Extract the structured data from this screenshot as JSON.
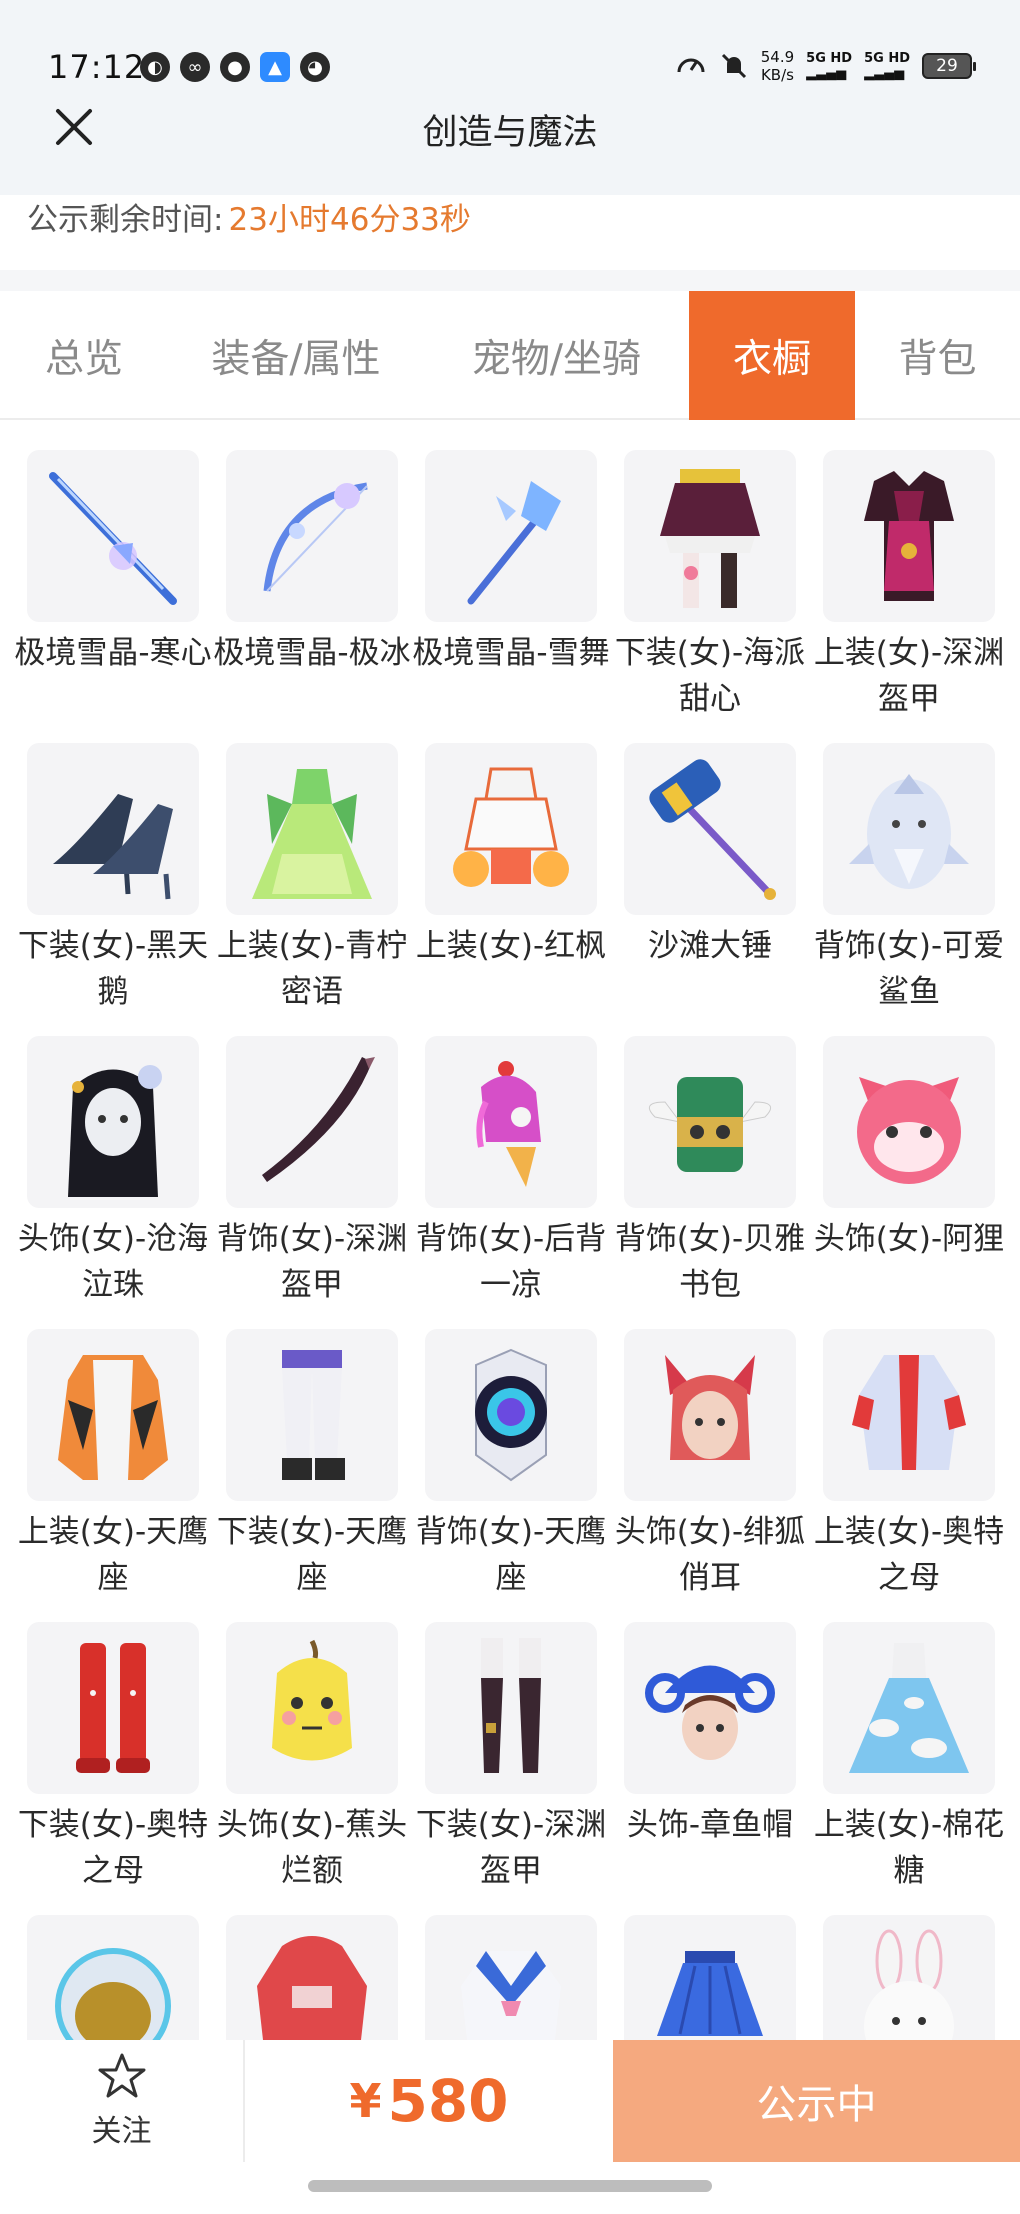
{
  "status_bar": {
    "time": "17:12",
    "net_speed_value": "54.9",
    "net_speed_unit": "KB/s",
    "sim1": "5G HD",
    "sim2": "5G HD",
    "battery": "29"
  },
  "header": {
    "title": "创造与魔法",
    "close_icon": "close-icon"
  },
  "notice": {
    "label": "公示剩余时间:",
    "value": "23小时46分33秒"
  },
  "tabs": [
    {
      "label": "总览",
      "active": false
    },
    {
      "label": "装备/属性",
      "active": false
    },
    {
      "label": "宠物/坐骑",
      "active": false
    },
    {
      "label": "衣橱",
      "active": true
    },
    {
      "label": "背包",
      "active": false
    }
  ],
  "items": [
    {
      "name": "极境雪晶-寒心",
      "icon": "ice-sword-icon"
    },
    {
      "name": "极境雪晶-极冰",
      "icon": "ice-bow-icon"
    },
    {
      "name": "极境雪晶-雪舞",
      "icon": "ice-staff-icon"
    },
    {
      "name": "下装(女)-海派甜心",
      "icon": "skirt-icon"
    },
    {
      "name": "上装(女)-深渊盔甲",
      "icon": "armor-icon"
    },
    {
      "name": "下装(女)-黑天鹅",
      "icon": "heels-icon"
    },
    {
      "name": "上装(女)-青柠密语",
      "icon": "green-dress-icon"
    },
    {
      "name": "上装(女)-红枫",
      "icon": "outfit-icon"
    },
    {
      "name": "沙滩大锤",
      "icon": "hammer-icon"
    },
    {
      "name": "背饰(女)-可爱鲨鱼",
      "icon": "shark-backpack-icon"
    },
    {
      "name": "头饰(女)-沧海泣珠",
      "icon": "hair-icon"
    },
    {
      "name": "背饰(女)-深渊盔甲",
      "icon": "blade-icon"
    },
    {
      "name": "背饰(女)-后背一凉",
      "icon": "icecream-icon"
    },
    {
      "name": "背饰(女)-贝雅书包",
      "icon": "winged-bag-icon"
    },
    {
      "name": "头饰(女)-阿狸",
      "icon": "fox-head-icon"
    },
    {
      "name": "上装(女)-天鹰座",
      "icon": "jacket-icon"
    },
    {
      "name": "下装(女)-天鹰座",
      "icon": "pants-icon"
    },
    {
      "name": "背饰(女)-天鹰座",
      "icon": "robot-backpack-icon"
    },
    {
      "name": "头饰(女)-绯狐俏耳",
      "icon": "fox-ears-icon"
    },
    {
      "name": "上装(女)-奥特之母",
      "icon": "top-icon"
    },
    {
      "name": "下装(女)-奥特之母",
      "icon": "boots-icon"
    },
    {
      "name": "头饰(女)-蕉头烂额",
      "icon": "banana-head-icon"
    },
    {
      "name": "下装(女)-深渊盔甲",
      "icon": "stockings-icon"
    },
    {
      "name": "头饰-章鱼帽",
      "icon": "octopus-hat-icon"
    },
    {
      "name": "上装(女)-棉花糖",
      "icon": "cloud-dress-icon"
    },
    {
      "name": "",
      "icon": "helmet-icon"
    },
    {
      "name": "",
      "icon": "hoodie-icon"
    },
    {
      "name": "",
      "icon": "sailor-top-icon"
    },
    {
      "name": "",
      "icon": "pleated-skirt-icon"
    },
    {
      "name": "",
      "icon": "rabbit-head-icon"
    }
  ],
  "bottom_bar": {
    "follow_label": "关注",
    "price_symbol": "¥",
    "price_value": "580",
    "action_label": "公示中"
  },
  "colors": {
    "accent": "#ef6a2c",
    "accent_light": "#f5a97f",
    "countdown": "#e57a2f"
  }
}
